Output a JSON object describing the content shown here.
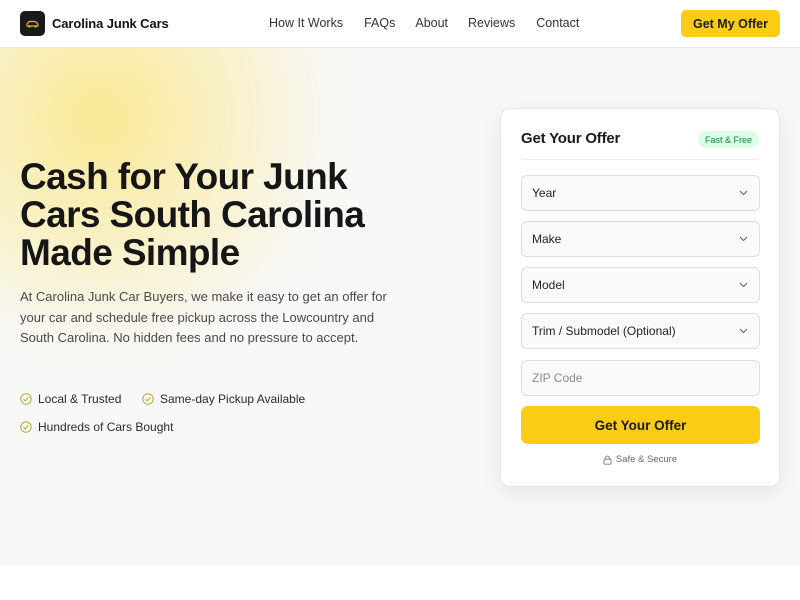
{
  "header": {
    "brand": "Carolina Junk Cars",
    "nav": [
      "How It Works",
      "FAQs",
      "About",
      "Reviews",
      "Contact"
    ],
    "cta_label": "Get My Offer"
  },
  "hero": {
    "headline_line1": "Cash for Your Junk",
    "headline_line2": "Cars South Carolina",
    "headline_line3": "Made Simple",
    "lead": "At Carolina Junk Car Buyers, we make it easy to get an offer for your car and schedule free pickup across the Lowcountry and South Carolina. No hidden fees and no pressure to accept.",
    "features": [
      "Local & Trusted",
      "Same-day Pickup Available",
      "Hundreds of Cars Bought"
    ]
  },
  "offer_form": {
    "title": "Get Your Offer",
    "badge": "Fast & Free",
    "year_select": "Year",
    "make_select": "Make",
    "model_select": "Model",
    "trim_select": "Trim / Submodel (Optional)",
    "zip_placeholder": "ZIP Code",
    "submit_label": "Get Your Offer",
    "secure_note": "Safe & Secure"
  },
  "colors": {
    "accent": "#facc15",
    "badge_bg": "#dcfce7",
    "badge_text": "#15803d",
    "check": "#a3a31a"
  },
  "icons": {
    "logo": "car-icon",
    "select_chevron": "chevron-down-icon",
    "feature_check": "check-circle-icon",
    "secure": "lock-icon"
  }
}
